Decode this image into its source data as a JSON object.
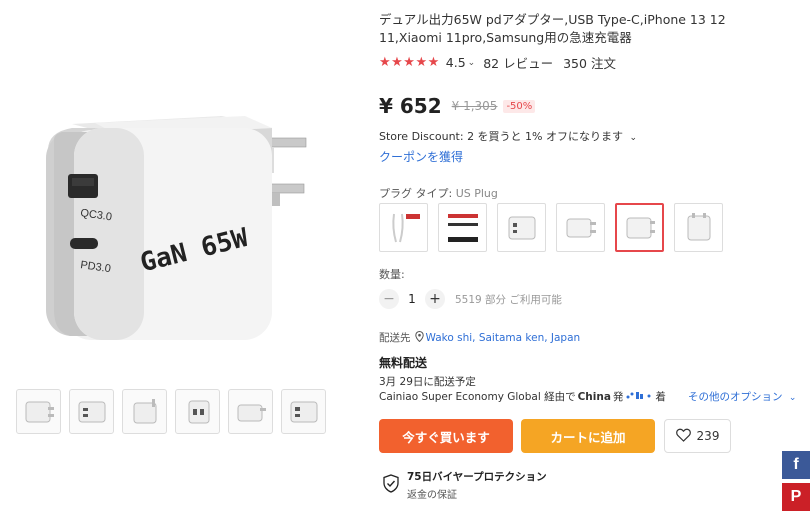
{
  "product": {
    "title": "デュアル出力65W pdアダプター,USB Type-C,iPhone 13 12 11,Xiaomi 11pro,Samsung用の急速充電器",
    "main_image": {
      "brand_text": "GaN 65W",
      "port1_label": "QC3.0",
      "port2_label": "PD3.0"
    }
  },
  "rating": {
    "stars": "★★★★★",
    "value": "4.5",
    "reviews": "82 レビュー",
    "orders": "350 注文"
  },
  "price": {
    "current": "¥ 652",
    "original": "¥ 1,305",
    "discount": "-50%"
  },
  "store_discount": "Store Discount: 2 を買うと 1% オフになります",
  "coupon": "クーポンを獲得",
  "plug_type": {
    "label": "プラグ タイプ:",
    "value": "US Plug"
  },
  "variant_count": 6,
  "selected_variant": 4,
  "quantity": {
    "label": "数量:",
    "value": "1",
    "stock": "5519 部分 ご利用可能"
  },
  "shipping": {
    "ship_to_label": "配送先",
    "location": "Wako shi, Saitama ken, Japan",
    "free": "無料配送",
    "delivery": "3月 29日に配送予定",
    "carrier_prefix": "Cainiao Super Economy Global 経由で",
    "carrier_country": "China",
    "carrier_suffix": "発",
    "carrier_end": "着",
    "other_options": "その他のオプション"
  },
  "actions": {
    "buy_now": "今すぐ買います",
    "add_to_cart": "カートに追加",
    "wishlist_count": "239"
  },
  "protection": {
    "title": "75日バイヤープロテクション",
    "subtitle": "返金の保証"
  },
  "social": {
    "facebook": "f",
    "pinterest": "P"
  },
  "colors": {
    "accent_red": "#e6474b",
    "buy_orange": "#f2612e",
    "cart_yellow": "#f5a524",
    "link_blue": "#2f6fd6"
  }
}
